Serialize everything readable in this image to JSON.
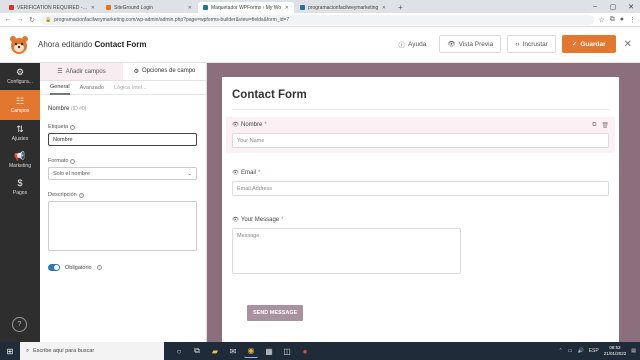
{
  "browser": {
    "tabs": [
      {
        "label": "VERIFICATION REQUIRED - Recu",
        "color": "#d93025",
        "active": false
      },
      {
        "label": "SiteGround Login",
        "color": "#e8711a",
        "active": false
      },
      {
        "label": "Maquetador WPForms ‹ My Wo",
        "color": "#21759b",
        "active": true
      },
      {
        "label": "programacionfacilweymarketing",
        "color": "#21759b",
        "active": false
      }
    ],
    "new_tab": "+",
    "url": "programacionfacilweymarketing.com/wp-admin/admin.php?page=wpforms-builder&view=fields&form_id=7",
    "win_controls": [
      "–",
      "▢",
      "✕"
    ]
  },
  "header": {
    "editing_prefix": "Ahora editando",
    "form_name": "Contact Form",
    "help_label": "Ayuda",
    "preview_label": "Vista Previa",
    "embed_label": "Incrustar",
    "save_label": "Guardar",
    "close_glyph": "✕"
  },
  "side_menu": {
    "items": [
      {
        "icon": "⚙",
        "label": "Configura..."
      },
      {
        "icon": "☷",
        "label": "Campos"
      },
      {
        "icon": "⇅",
        "label": "Ajustes"
      },
      {
        "icon": "📢",
        "label": "Marketing"
      },
      {
        "icon": "$",
        "label": "Pagos"
      }
    ],
    "help_glyph": "?"
  },
  "panel": {
    "tab_add": "Añadir campos",
    "tab_options": "Opciones de campo",
    "sub_general": "General",
    "sub_advanced": "Avanzado",
    "sub_logic": "Lógica Intel...",
    "field_title": "Nombre",
    "field_id": "(ID #0)",
    "label_label": "Etiqueta",
    "label_value": "Nombre",
    "format_label": "Formato",
    "format_value": "Solo el nombre",
    "description_label": "Descripción",
    "required_label": "Obligatorio"
  },
  "form": {
    "title": "Contact Form",
    "name_label": "Nombre",
    "name_placeholder": "Your Name",
    "email_label": "Email",
    "email_placeholder": "Email Address",
    "message_label": "Your Message",
    "message_placeholder": "Message",
    "required_mark": "*",
    "submit_label": "SEND MESSAGE"
  },
  "taskbar": {
    "search_placeholder": "Escribe aquí para buscar",
    "language": "ESP",
    "time": "08:52",
    "date": "21/01/2022"
  },
  "colors": {
    "accent": "#e27730",
    "sidebar": "#2e2e2e",
    "preview_bg": "#8b6f7c",
    "toggle": "#2e7ab8"
  }
}
